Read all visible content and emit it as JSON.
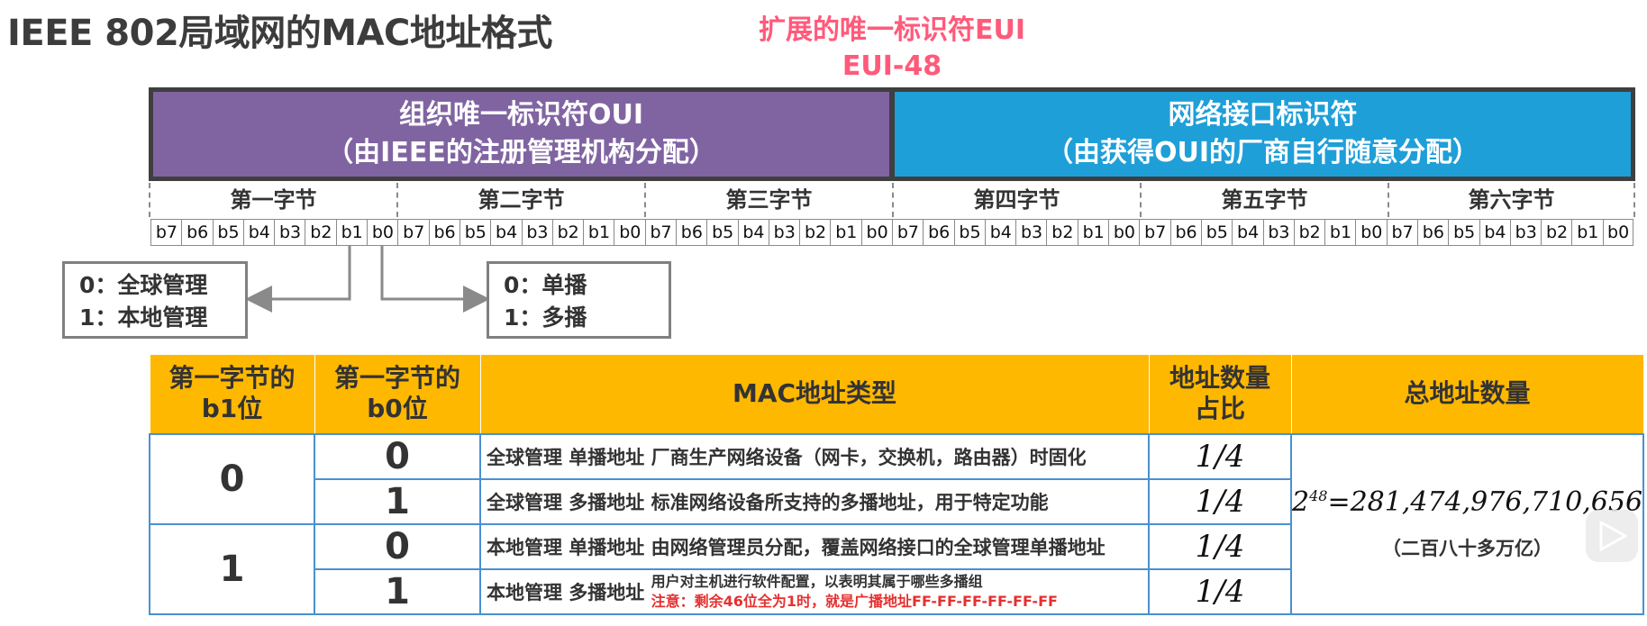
{
  "title": "IEEE 802局域网的MAC地址格式",
  "eui": {
    "line1": "扩展的唯一标识符EUI",
    "line2": "EUI-48"
  },
  "header": {
    "oui": {
      "line1": "组织唯一标识符OUI",
      "line2": "（由IEEE的注册管理机构分配）"
    },
    "nic": {
      "line1": "网络接口标识符",
      "line2": "（由获得OUI的厂商自行随意分配）"
    }
  },
  "bytes": [
    "第一字节",
    "第二字节",
    "第三字节",
    "第四字节",
    "第五字节",
    "第六字节"
  ],
  "bits": [
    "b7",
    "b6",
    "b5",
    "b4",
    "b3",
    "b2",
    "b1",
    "b0"
  ],
  "b1_box": {
    "line1": "0：全球管理",
    "line2": "1：本地管理"
  },
  "b0_box": {
    "line1": "0：单播",
    "line2": "1：多播"
  },
  "table": {
    "headers": [
      "第一字节的b1位",
      "第一字节的b0位",
      "MAC地址类型",
      "地址数量占比",
      "总地址数量"
    ],
    "b1_values": [
      "0",
      "1"
    ],
    "rows": [
      {
        "b0": "0",
        "type": "全球管理  单播地址  厂商生产网络设备（网卡，交换机，路由器）时固化",
        "ratio": "1/4"
      },
      {
        "b0": "1",
        "type": "全球管理  多播地址  标准网络设备所支持的多播地址，用于特定功能",
        "ratio": "1/4"
      },
      {
        "b0": "0",
        "type": "本地管理  单播地址  由网络管理员分配，覆盖网络接口的全球管理单播地址",
        "ratio": "1/4"
      },
      {
        "b0": "1",
        "type_prefix": "本地管理  多播地址",
        "type_note1": "用户对主机进行软件配置，以表明其属于哪些多播组",
        "type_note2": "注意：剩余46位全为1时，就是广播地址FF-FF-FF-FF-FF-FF",
        "ratio": "1/4"
      }
    ],
    "total": {
      "base": "2",
      "exp": "48",
      "value": "=281,474,976,710,656",
      "note": "（二百八十多万亿）"
    }
  },
  "colors": {
    "oui": "#8064a2",
    "nic": "#1f9fd8",
    "header": "#ffb800",
    "eui": "#ff5a7a",
    "note": "#e53030"
  }
}
